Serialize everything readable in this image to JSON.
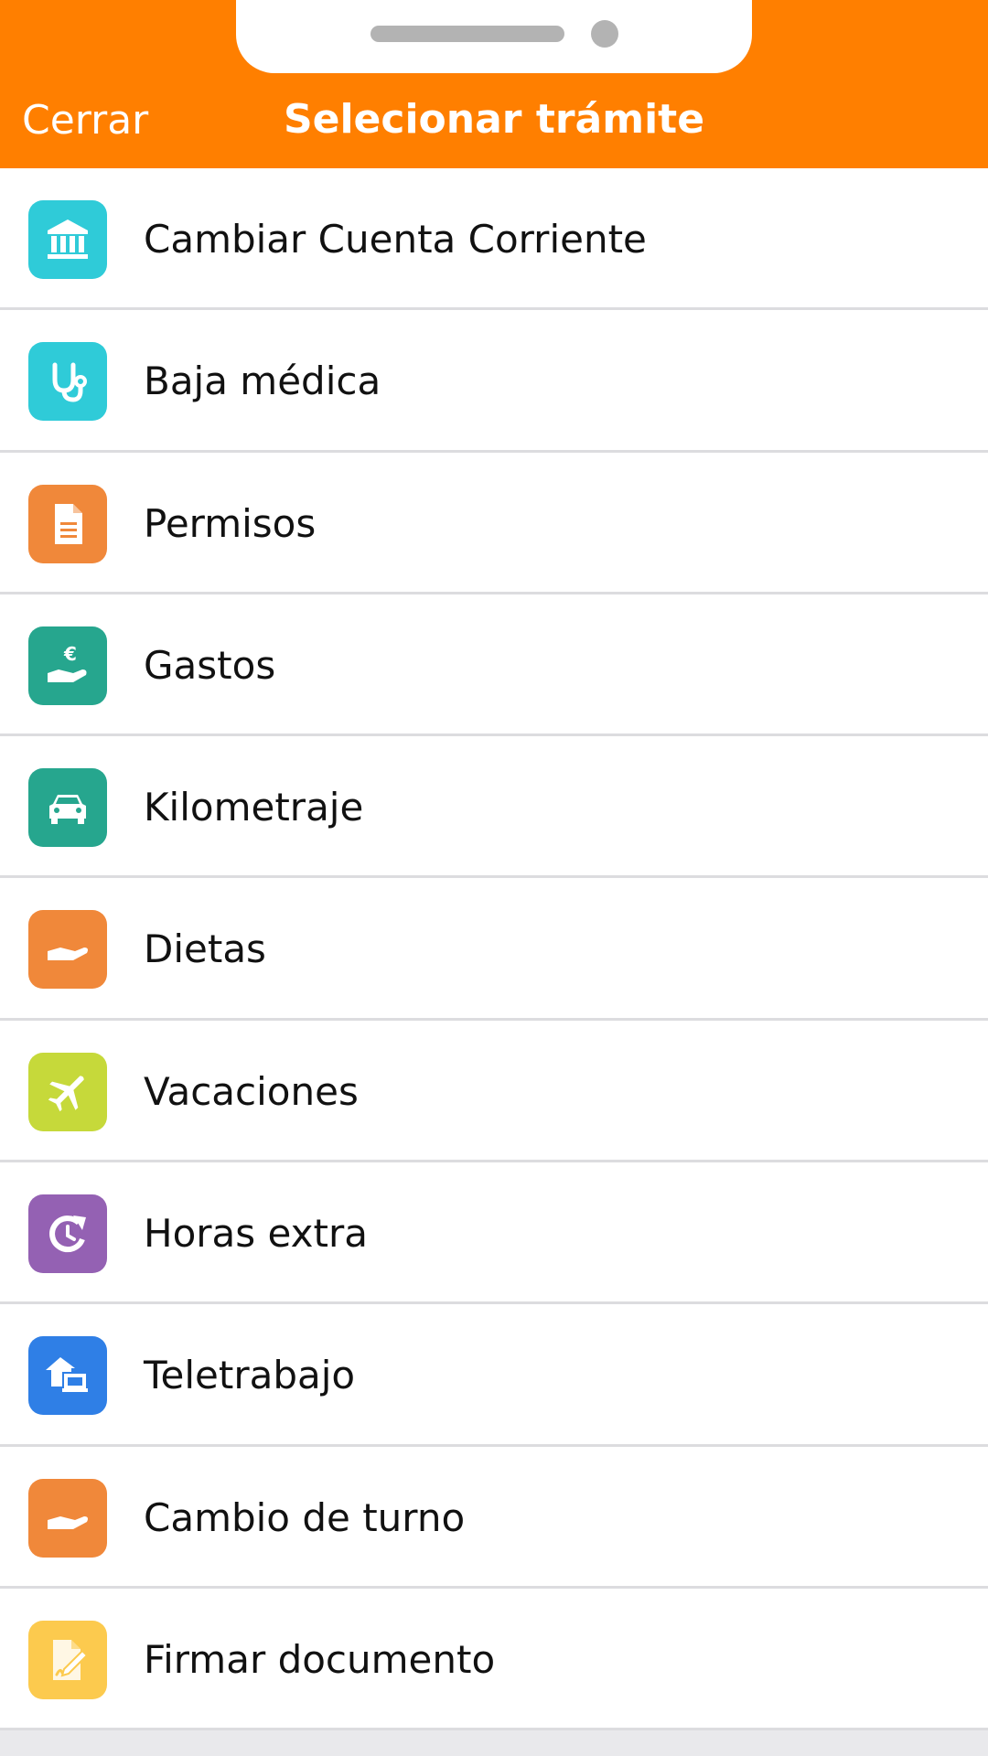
{
  "header": {
    "close_label": "Cerrar",
    "title": "Selecionar trámite",
    "background_color": "#ff7f00"
  },
  "procedures": [
    {
      "label": "Cambiar Cuenta Corriente",
      "icon": "bank-icon",
      "color": "#2fcbd8"
    },
    {
      "label": "Baja médica",
      "icon": "stethoscope-icon",
      "color": "#2fcbd8"
    },
    {
      "label": "Permisos",
      "icon": "document-icon",
      "color": "#f0883a"
    },
    {
      "label": "Gastos",
      "icon": "euro-hand-icon",
      "color": "#26a68e"
    },
    {
      "label": "Kilometraje",
      "icon": "car-icon",
      "color": "#26a68e"
    },
    {
      "label": "Dietas",
      "icon": "hand-icon",
      "color": "#f0883a"
    },
    {
      "label": "Vacaciones",
      "icon": "airplane-icon",
      "color": "#c6d93a"
    },
    {
      "label": "Horas extra",
      "icon": "clock-arrow-icon",
      "color": "#9461b3"
    },
    {
      "label": "Teletrabajo",
      "icon": "home-laptop-icon",
      "color": "#2f7fe6"
    },
    {
      "label": "Cambio de turno",
      "icon": "hand-icon",
      "color": "#f0883a"
    },
    {
      "label": "Firmar documento",
      "icon": "sign-document-icon",
      "color": "#fcca4e"
    }
  ]
}
